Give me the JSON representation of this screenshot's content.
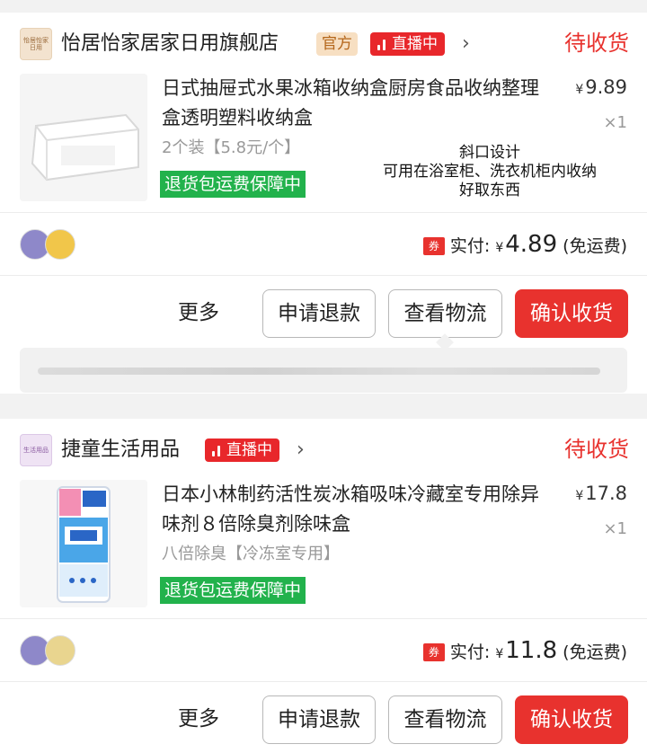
{
  "orders": [
    {
      "shop_logo_text": "怡居怡家日用",
      "shop_name": "怡居怡家居家日用旗舰店",
      "official_badge": "官方",
      "live_badge": "直播中",
      "status": "待收货",
      "product_title": "日式抽屉式水果冰箱收纳盒厨房食品收纳整理盒透明塑料收纳盒",
      "currency": "¥",
      "price": "9.89",
      "quantity": "×1",
      "sku": "2个装【5.8元/个】",
      "guarantee": "退货包运费保障中",
      "note_lines": [
        "斜口设计",
        "可用在浴室柜、洗衣机柜内收纳",
        "好取东西"
      ],
      "coupon": "券",
      "paid_label": "实付:",
      "paid_amount": "4.89",
      "shipping": "(免运费)",
      "more": "更多",
      "refund_button": "申请退款",
      "logistics_button": "查看物流",
      "confirm_button": "确认收货"
    },
    {
      "shop_logo_text": "生活用品",
      "shop_name": "捷童生活用品",
      "live_badge": "直播中",
      "status": "待收货",
      "product_title": "日本小林制药活性炭冰箱吸味冷藏室专用除异味剂８倍除臭剂除味盒",
      "currency": "¥",
      "price": "17.8",
      "quantity": "×1",
      "sku": "八倍除臭【冷冻室专用】",
      "guarantee": "退货包运费保障中",
      "coupon": "券",
      "paid_label": "实付:",
      "paid_amount": "11.8",
      "shipping": "(免运费)",
      "more": "更多",
      "refund_button": "申请退款",
      "logistics_button": "查看物流",
      "confirm_button": "确认收货"
    }
  ],
  "colors": {
    "accent_red": "#e8322e",
    "guarantee_green": "#22b24c",
    "official_badge_bg": "#f7dfc2"
  }
}
